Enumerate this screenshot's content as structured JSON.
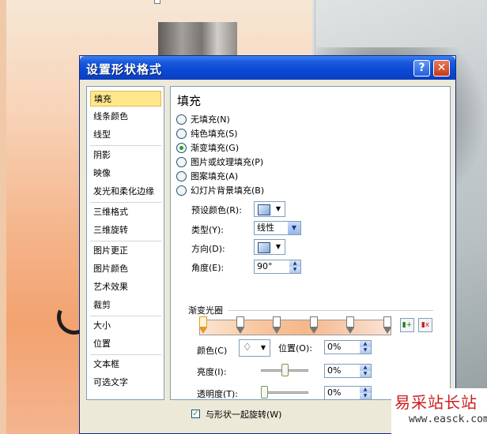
{
  "dialog": {
    "title": "设置形状格式",
    "help_glyph": "?",
    "close_glyph": "✕"
  },
  "nav": {
    "items": [
      {
        "label": "填充",
        "selected": true
      },
      {
        "label": "线条颜色"
      },
      {
        "label": "线型"
      },
      {
        "label": "阴影"
      },
      {
        "label": "映像"
      },
      {
        "label": "发光和柔化边缘"
      },
      {
        "label": "三维格式"
      },
      {
        "label": "三维旋转"
      },
      {
        "label": "图片更正"
      },
      {
        "label": "图片颜色"
      },
      {
        "label": "艺术效果"
      },
      {
        "label": "裁剪"
      },
      {
        "label": "大小"
      },
      {
        "label": "位置"
      },
      {
        "label": "文本框"
      },
      {
        "label": "可选文字"
      }
    ]
  },
  "panel": {
    "title": "填充",
    "fill_options": [
      {
        "label": "无填充(N)",
        "checked": false
      },
      {
        "label": "纯色填充(S)",
        "checked": false
      },
      {
        "label": "渐变填充(G)",
        "checked": true
      },
      {
        "label": "图片或纹理填充(P)",
        "checked": false
      },
      {
        "label": "图案填充(A)",
        "checked": false
      },
      {
        "label": "幻灯片背景填充(B)",
        "checked": false
      }
    ],
    "preset_colors_label": "预设颜色(R):",
    "type_label": "类型(Y):",
    "type_value": "线性",
    "direction_label": "方向(D):",
    "angle_label": "角度(E):",
    "angle_value": "90°",
    "gradient_stops_label": "渐变光圈",
    "gradient_stops_count": 6,
    "color_label": "颜色(C)",
    "position_label": "位置(O):",
    "position_value": "0%",
    "brightness_label": "亮度(I):",
    "brightness_value": "0%",
    "brightness_level": 0.5,
    "transparency_label": "透明度(T):",
    "transparency_value": "0%",
    "transparency_level": 0,
    "rotate_with_shape_label": "与形状一起旋转(W)",
    "rotate_with_shape_checked": true
  },
  "watermark": {
    "site_name": "易采站长站",
    "url": "www.easck.com"
  },
  "colors": {
    "titlebar": "#0b49d5",
    "selected_nav": "#ffe78e",
    "dialog_bg": "#ece9d8"
  }
}
